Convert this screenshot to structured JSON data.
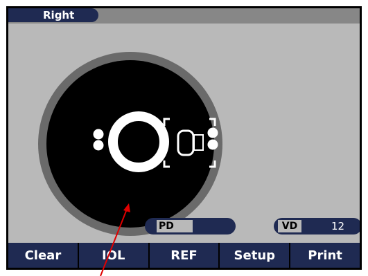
{
  "header": {
    "eye_label": "Right"
  },
  "readouts": {
    "pd_label": "PD",
    "pd_value": "",
    "vd_label": "VD",
    "vd_value": "12"
  },
  "menu": {
    "items": [
      {
        "label": "Clear"
      },
      {
        "label": "IOL"
      },
      {
        "label": "REF"
      },
      {
        "label": "Setup"
      },
      {
        "label": "Print"
      }
    ]
  },
  "colors": {
    "screen_bg": "#b9b9b9",
    "bar_navy": "#1f2a52",
    "arrow_red": "#e00000"
  }
}
